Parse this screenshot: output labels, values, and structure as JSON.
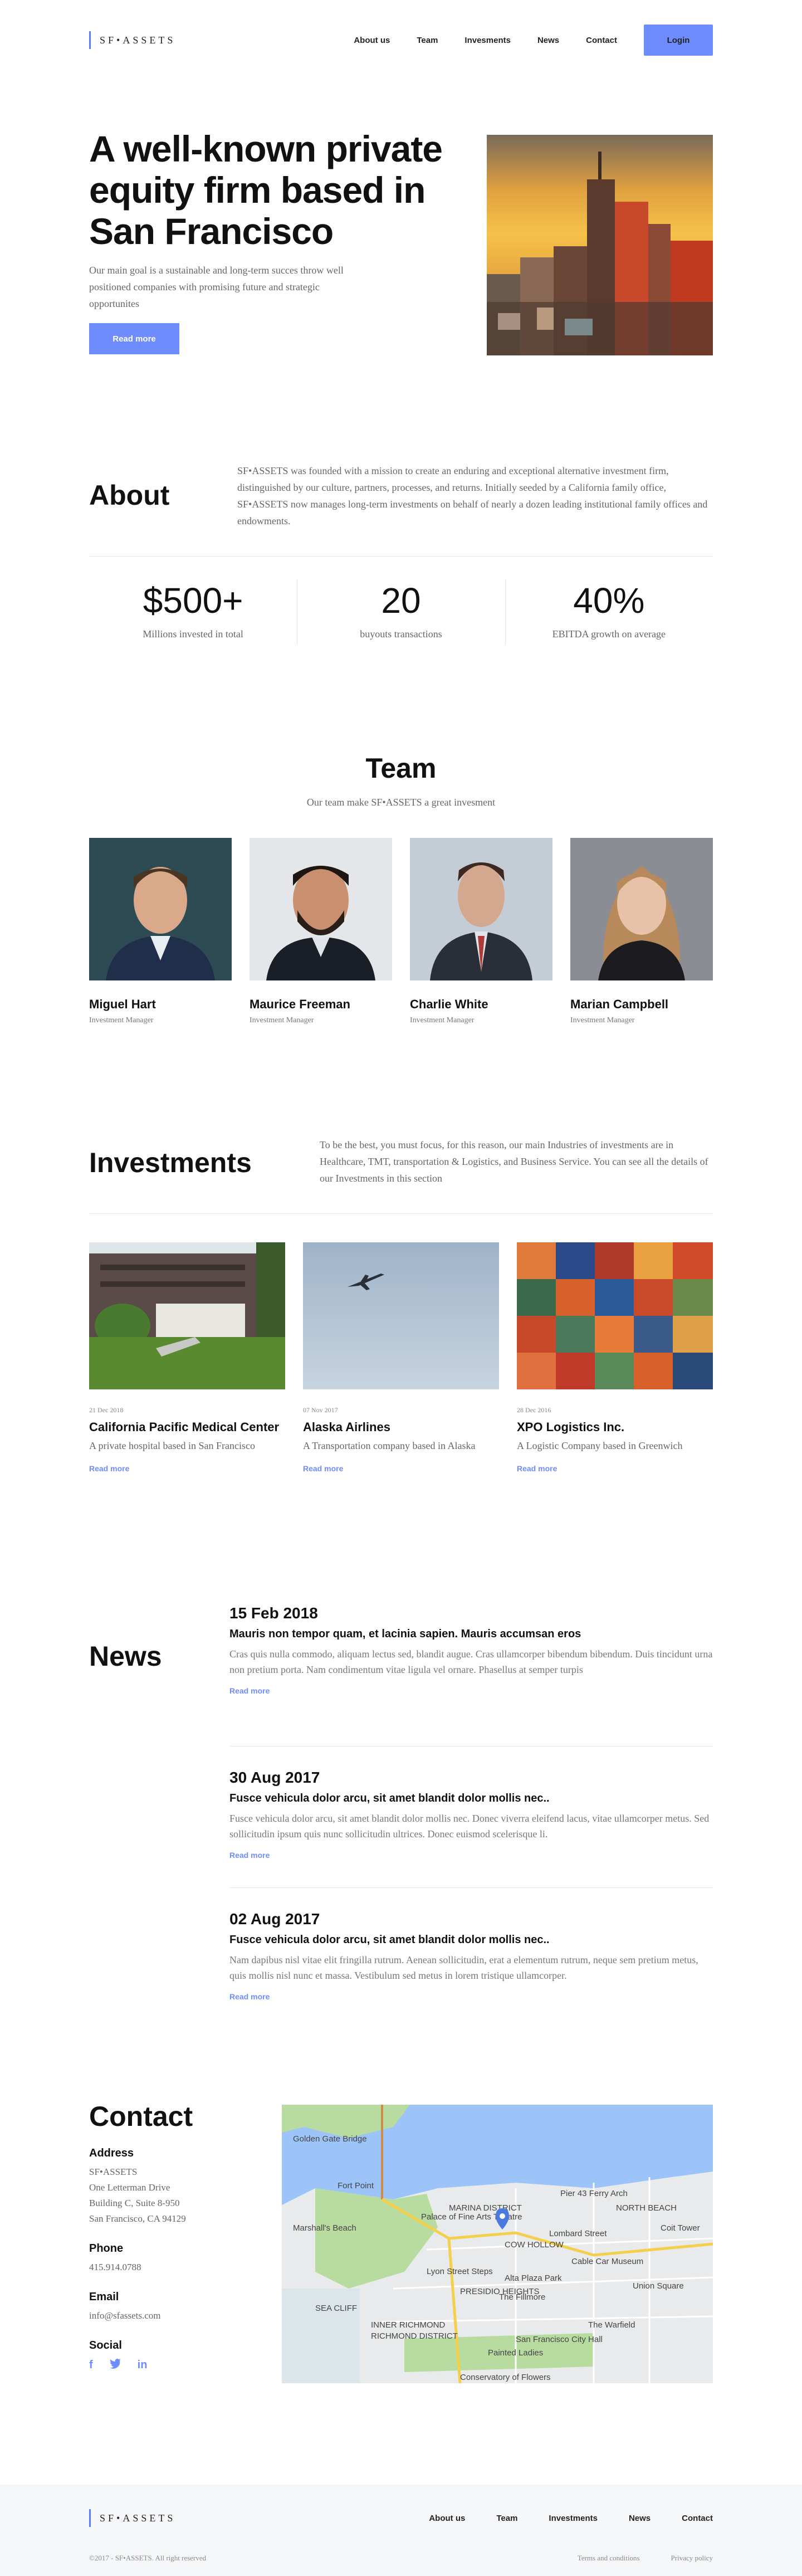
{
  "header": {
    "logo_text": "SF•ASSETS",
    "nav": [
      "About us",
      "Team",
      "Invesments",
      "News",
      "Contact"
    ],
    "login_label": "Login"
  },
  "hero": {
    "title": "A well-known private equity firm based in San Francisco",
    "text": "Our main goal is a sustainable and long-term succes throw well positioned companies with promising future and strategic opportunites",
    "button": "Read more"
  },
  "about": {
    "title": "About",
    "text": "SF•ASSETS was founded with a mission to create an enduring and exceptional alternative investment firm, distinguished by our culture, partners, processes, and returns. Initially seeded by a California family office, SF•ASSETS now manages long-term investments on behalf of nearly a dozen leading institutional family offices and endowments.",
    "stats": [
      {
        "value": "$500+",
        "label": "Millions invested in total"
      },
      {
        "value": "20",
        "label": "buyouts transactions"
      },
      {
        "value": "40%",
        "label": "EBITDA growth on average"
      }
    ]
  },
  "team": {
    "title": "Team",
    "subtitle": "Our team make SF•ASSETS a great invesment",
    "members": [
      {
        "name": "Miguel Hart",
        "role": "Investment Manager"
      },
      {
        "name": "Maurice Freeman",
        "role": "Investment Manager"
      },
      {
        "name": "Charlie White",
        "role": "Investment Manager"
      },
      {
        "name": "Marian Campbell",
        "role": "Investment Manager"
      }
    ]
  },
  "investments": {
    "title": "Investments",
    "text": "To be the best, you must focus, for this reason, our main Industries of investments are in Healthcare, TMT, transportation & Logistics, and Business Service. You can see all the details of our Investments in this section",
    "items": [
      {
        "date": "21 Dec 2018",
        "name": "California Pacific Medical Center",
        "desc": "A private hospital based in San Francisco",
        "link": "Read more"
      },
      {
        "date": "07 Nov 2017",
        "name": "Alaska Airlines",
        "desc": "A Transportation company based in Alaska",
        "link": "Read more"
      },
      {
        "date": "28 Dec 2016",
        "name": "XPO Logistics Inc.",
        "desc": "A Logistic Company  based in Greenwich",
        "link": "Read more"
      }
    ]
  },
  "news": {
    "title": "News",
    "items": [
      {
        "date": "15 Feb 2018",
        "headline": "Mauris non tempor quam, et lacinia sapien. Mauris accumsan eros",
        "body": "Cras quis nulla commodo, aliquam lectus sed, blandit augue. Cras ullamcorper bibendum bibendum. Duis tincidunt urna non pretium porta. Nam condimentum vitae ligula vel ornare. Phasellus at semper turpis",
        "link": "Read more"
      },
      {
        "date": "30 Aug 2017",
        "headline": "Fusce vehicula dolor arcu, sit amet blandit dolor mollis nec..",
        "body": "Fusce vehicula dolor arcu, sit amet blandit dolor mollis nec. Donec viverra eleifend lacus, vitae ullamcorper metus. Sed sollicitudin ipsum quis nunc sollicitudin ultrices. Donec euismod scelerisque li.",
        "link": "Read more"
      },
      {
        "date": "02 Aug 2017",
        "headline": "Fusce vehicula dolor arcu, sit amet blandit dolor mollis nec..",
        "body": "Nam dapibus nisl vitae elit fringilla rutrum. Aenean sollicitudin, erat a elementum rutrum, neque sem pretium metus, quis mollis nisl nunc et massa. Vestibulum sed metus in lorem tristique ullamcorper.",
        "link": "Read more"
      }
    ]
  },
  "contact": {
    "title": "Contact",
    "address_label": "Address",
    "address_lines": [
      "SF•ASSETS",
      "One Letterman Drive",
      "Building C, Suite 8-950",
      "San Francisco, CA 94129"
    ],
    "phone_label": "Phone",
    "phone": "415.914.0788",
    "email_label": "Email",
    "email": "info@sfassets.com",
    "social_label": "Social",
    "map_labels": [
      "Golden Gate Bridge",
      "Fort Point",
      "Marshall's Beach",
      "Palace of Fine Arts Theatre",
      "Pier 43 Ferry Arch",
      "Lombard Street",
      "COW HOLLOW",
      "MARINA DISTRICT",
      "NORTH BEACH",
      "Cable Car Museum",
      "Alta Plaza Park",
      "Lyon Street Steps",
      "The Fillmore",
      "Union Square",
      "The Warfield",
      "Painted Ladies",
      "San Francisco City Hall",
      "Conservatory of Flowers",
      "PRESIDIO HEIGHTS",
      "RICHMOND DISTRICT",
      "INNER RICHMOND",
      "SEA CLIFF",
      "Coit Tower"
    ]
  },
  "footer": {
    "logo_text": "SF•ASSETS",
    "nav": [
      "About us",
      "Team",
      "Investments",
      "News",
      "Contact"
    ],
    "copyright": "©2017 - SF•ASSETS. All right reserved",
    "legal": [
      "Terms and conditions",
      "Privacy policy"
    ]
  },
  "colors": {
    "accent": "#6f8cff",
    "text": "#111111",
    "muted": "#666666",
    "footer_bg": "#f6f7f9"
  }
}
